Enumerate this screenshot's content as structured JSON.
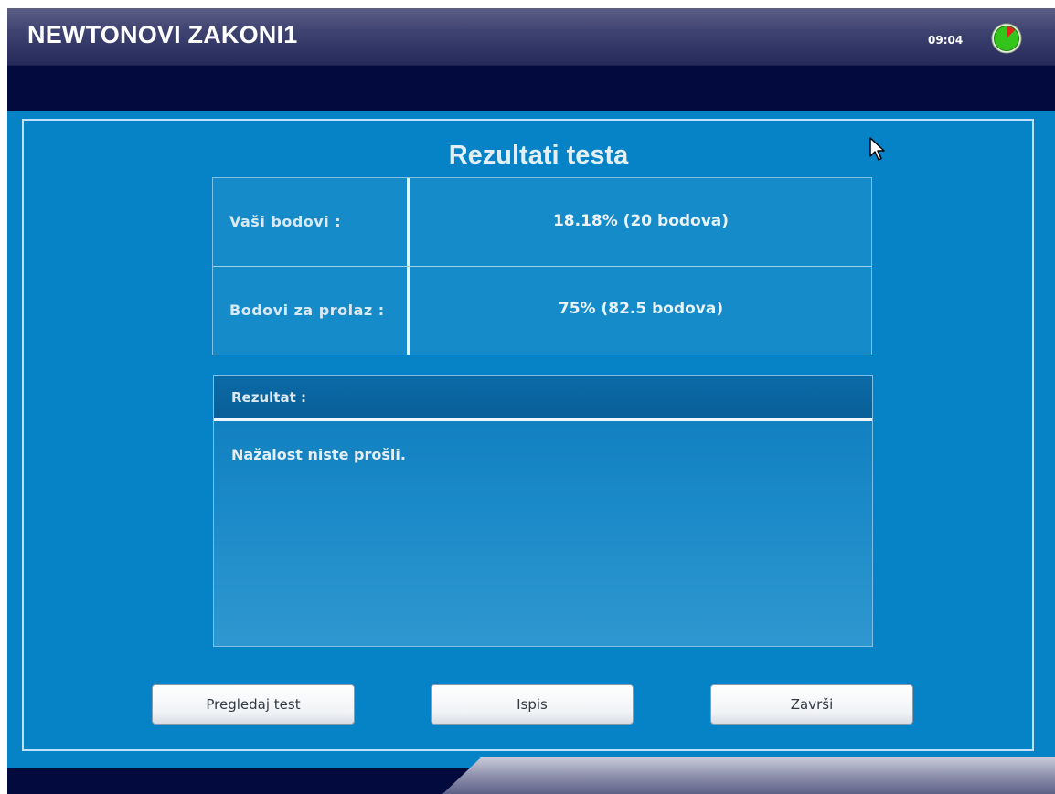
{
  "header": {
    "title": "NEWTONOVI ZAKONI1",
    "time": "09:04",
    "timer_icon": "timer-icon"
  },
  "results": {
    "heading": "Rezultati testa",
    "rows": [
      {
        "label": "Vaši bodovi :",
        "value": "18.18% (20 bodova)"
      },
      {
        "label": "Bodovi za prolaz :",
        "value": "75%  (82.5 bodova)"
      }
    ],
    "result_label": "Rezultat :",
    "result_text": "Nažalost niste prošli."
  },
  "buttons": {
    "review": "Pregledaj test",
    "print": "Ispis",
    "finish": "Završi"
  },
  "colors": {
    "background": "#020a3e",
    "panel": "#0583c6",
    "timer_green": "#34c51c",
    "timer_red": "#e0241c"
  }
}
